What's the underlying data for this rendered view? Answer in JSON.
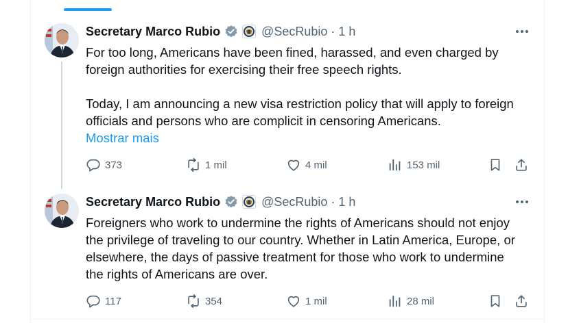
{
  "tweets": [
    {
      "author_name": "Secretary Marco Rubio",
      "handle": "@SecRubio",
      "separator": "·",
      "time": "1 h",
      "text_paragraphs": [
        "For too long, Americans have been fined, harassed, and even charged by foreign authorities for exercising their free speech rights.",
        "Today, I am announcing a new visa restriction policy that will apply to foreign officials and persons who are complicit in censoring Americans."
      ],
      "show_more": "Mostrar mais",
      "replies": "373",
      "reposts": "1 mil",
      "likes": "4 mil",
      "views": "153 mil"
    },
    {
      "author_name": "Secretary Marco Rubio",
      "handle": "@SecRubio",
      "separator": "·",
      "time": "1 h",
      "text": "Foreigners who work to undermine the rights of Americans should not enjoy the privilege of traveling to our country.  Whether in Latin America, Europe, or elsewhere, the days of passive treatment for those who work to undermine the rights of Americans are over.",
      "replies": "117",
      "reposts": "354",
      "likes": "1 mil",
      "views": "28 mil"
    }
  ],
  "colors": {
    "accent": "#1d9bf0",
    "muted": "#536471",
    "text": "#0f1419"
  },
  "icons": [
    "verified-badge-icon",
    "government-seal-icon",
    "more-icon",
    "reply-icon",
    "repost-icon",
    "like-icon",
    "views-icon",
    "bookmark-icon",
    "share-icon"
  ]
}
